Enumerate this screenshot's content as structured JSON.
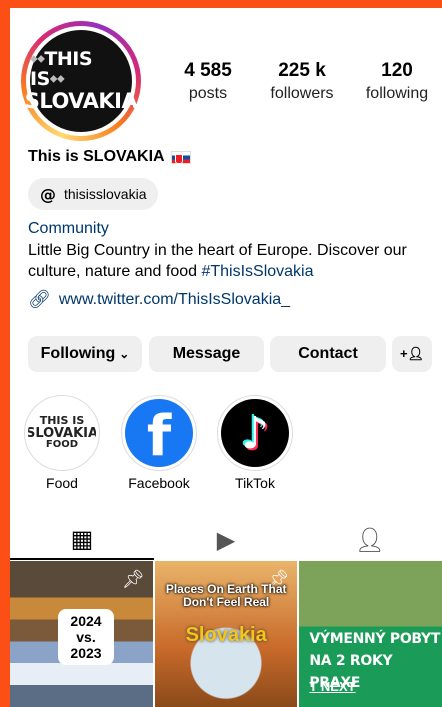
{
  "profile": {
    "avatar_line1": "THIS IS",
    "avatar_line2": "SLOVAKIA",
    "name": "This is SLOVAKIA",
    "threads_handle": "thisisslovakia",
    "category": "Community",
    "bio_text": "Little Big Country in the heart of Europe. Discover our culture, nature and food ",
    "bio_hashtag": "#ThisIsSlovakia",
    "link": "www.twitter.com/ThisIsSlovakia_"
  },
  "stats": [
    {
      "value": "4 585",
      "label": "posts"
    },
    {
      "value": "225 k",
      "label": "followers"
    },
    {
      "value": "120",
      "label": "following"
    }
  ],
  "buttons": {
    "following": "Following",
    "message": "Message",
    "contact": "Contact"
  },
  "highlights": [
    {
      "label": "Food",
      "logo_line1": "THIS IS",
      "logo_line2": "SLOVAKIA",
      "logo_line3": "FOOD"
    },
    {
      "label": "Facebook"
    },
    {
      "label": "TikTok"
    }
  ],
  "tabs": [
    "grid-icon",
    "reels-icon",
    "tagged-icon"
  ],
  "posts": [
    {
      "badge_line1": "2024",
      "badge_line2": "vs.",
      "badge_line3": "2023",
      "pinned": true
    },
    {
      "caption": "Places On Earth That Don't Feel Real",
      "title": "Slovakia",
      "pinned": true
    },
    {
      "promo_line1": "VÝMENNÝ POBYT",
      "promo_line2": "NA 2 ROKY PRAXE",
      "brand": "NEXT"
    }
  ],
  "colors": {
    "accent_frame": "#fc4f16",
    "link": "#00376b",
    "button_bg": "#efefef"
  }
}
